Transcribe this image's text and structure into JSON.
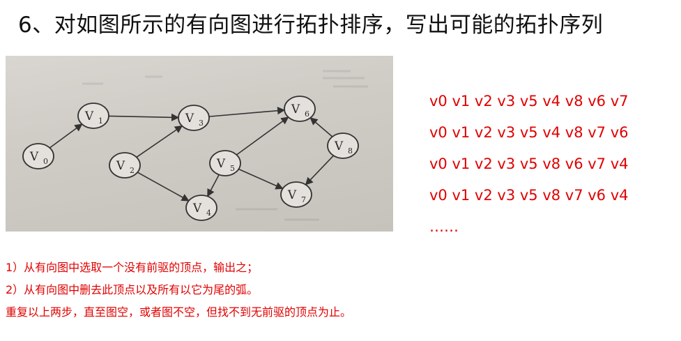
{
  "title": "6、对如图所示的有向图进行拓扑排序，写出可能的拓扑序列",
  "graph": {
    "nodes": [
      {
        "id": "v0",
        "label": "V",
        "sub": "0"
      },
      {
        "id": "v1",
        "label": "V",
        "sub": "1"
      },
      {
        "id": "v2",
        "label": "V",
        "sub": "2"
      },
      {
        "id": "v3",
        "label": "V",
        "sub": "3"
      },
      {
        "id": "v4",
        "label": "V",
        "sub": "4"
      },
      {
        "id": "v5",
        "label": "V",
        "sub": "5"
      },
      {
        "id": "v6",
        "label": "V",
        "sub": "6"
      },
      {
        "id": "v7",
        "label": "V",
        "sub": "7"
      },
      {
        "id": "v8",
        "label": "V",
        "sub": "8"
      }
    ],
    "edges": [
      [
        "v0",
        "v1"
      ],
      [
        "v1",
        "v3"
      ],
      [
        "v2",
        "v3"
      ],
      [
        "v2",
        "v4"
      ],
      [
        "v3",
        "v6"
      ],
      [
        "v5",
        "v4"
      ],
      [
        "v5",
        "v6"
      ],
      [
        "v5",
        "v7"
      ],
      [
        "v8",
        "v6"
      ],
      [
        "v8",
        "v7"
      ]
    ]
  },
  "sequences": [
    "v0 v1 v2 v3 v5 v4 v8 v6 v7",
    "v0 v1 v2 v3 v5 v4 v8 v7 v6",
    "v0 v1 v2 v3 v5 v8 v6 v7 v4",
    "v0 v1 v2 v3 v5 v8 v7 v6 v4",
    "……"
  ],
  "steps": [
    "1）从有向图中选取一个没有前驱的顶点，输出之；",
    "2）从有向图中删去此顶点以及所有以它为尾的弧。",
    "重复以上两步，直至图空，或者图不空，但找不到无前驱的顶点为止。"
  ],
  "colors": {
    "accent": "#e00000",
    "text": "#111111",
    "ink": "#333333",
    "photo_bg": "#cfcbc5"
  }
}
